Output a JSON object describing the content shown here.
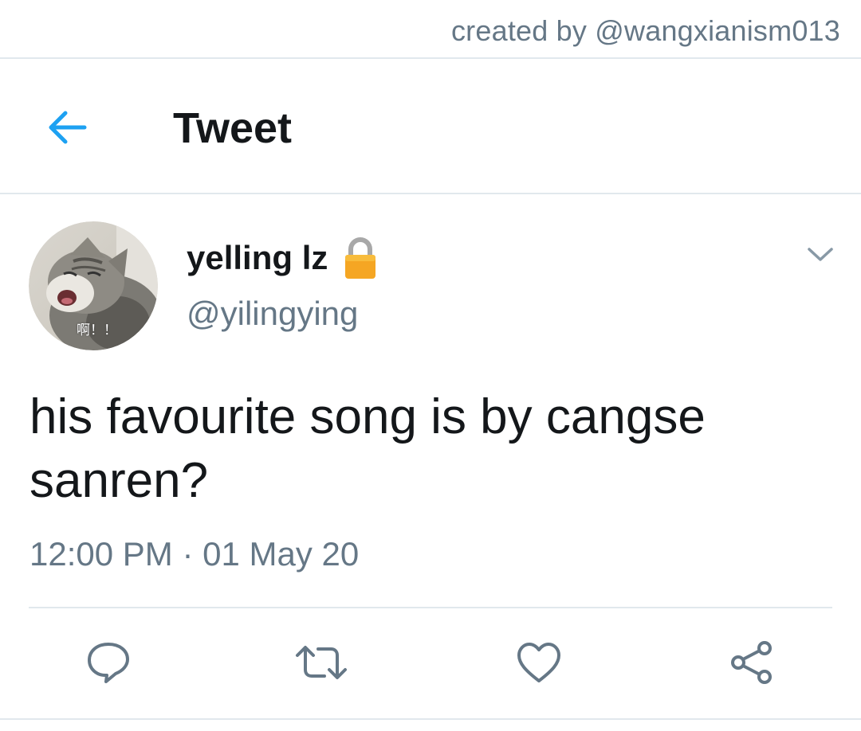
{
  "credit": {
    "text": "created by @wangxianism013"
  },
  "header": {
    "title": "Tweet",
    "back_icon": "arrow-left-icon",
    "accent_color": "#1da1f2"
  },
  "tweet": {
    "author": {
      "display_name": "yelling lz",
      "handle": "@yilingying",
      "avatar_caption": "啊！！",
      "protected_icon": "lock-icon"
    },
    "text": "his favourite song is by cangse sanren?",
    "timestamp": "12:00 PM · 01 May 20"
  },
  "actions": [
    {
      "name": "reply",
      "icon": "speech-bubble-icon"
    },
    {
      "name": "retweet",
      "icon": "retweet-arrows-icon"
    },
    {
      "name": "like",
      "icon": "heart-icon"
    },
    {
      "name": "share",
      "icon": "share-nodes-icon"
    }
  ],
  "colors": {
    "text_primary": "#14171a",
    "text_secondary": "#657786",
    "divider": "#e1e8ed",
    "accent": "#1da1f2",
    "lock": "#f5a623"
  }
}
